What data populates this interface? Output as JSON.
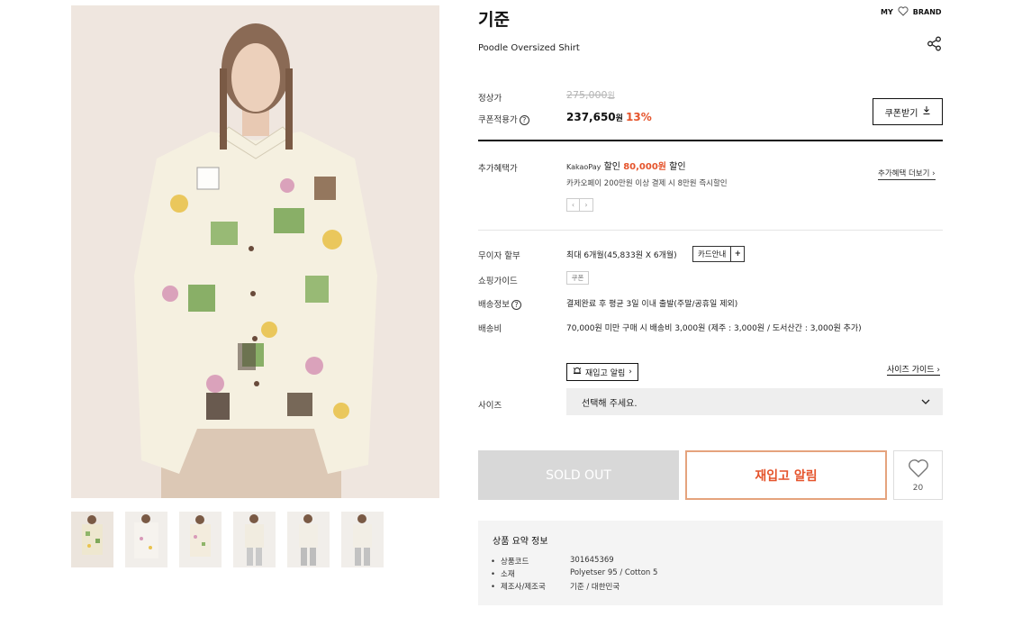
{
  "header": {
    "brand": "기준",
    "product_name": "Poodle Oversized Shirt",
    "my_label": "MY",
    "brand_link": "BRAND"
  },
  "gallery": {
    "thumbnail_count": 6
  },
  "price": {
    "regular_label": "정상가",
    "regular_value": "275,000",
    "regular_unit": "원",
    "coupon_label": "쿠폰적용가",
    "sale_value": "237,650",
    "sale_unit": "원",
    "discount": "13%",
    "coupon_button": "쿠폰받기"
  },
  "benefit": {
    "label": "추가혜택가",
    "provider": "KakaoPay",
    "prefix": "할인",
    "amount": "80,000원",
    "suffix": "할인",
    "sub": "카카오페이 200만원 이상 결제 시 8만원 즉시할인",
    "more": "추가혜택 더보기",
    "prev": "‹",
    "next": "›"
  },
  "installment": {
    "label": "무이자 할부",
    "value": "최대 6개월(45,833원 X 6개월)",
    "card_guide": "카드안내",
    "plus": "+"
  },
  "shopping_guide": {
    "label": "쇼핑가이드",
    "tag": "쿠폰"
  },
  "delivery_info": {
    "label": "배송정보",
    "value": "결제완료 후 평균 3일 이내 출발(주말/공휴일 제외)"
  },
  "delivery_fee": {
    "label": "배송비",
    "value": "70,000원 미만 구매 시 배송비 3,000원 (제주 : 3,000원 / 도서산간 : 3,000원 추가)"
  },
  "size": {
    "label": "사이즈",
    "restock_small": "재입고 알림",
    "size_guide": "사이즈 가이드",
    "placeholder": "선택해 주세요."
  },
  "actions": {
    "sold_out": "SOLD OUT",
    "restock": "재입고 알림",
    "wish_count": "20"
  },
  "summary": {
    "title": "상품 요약 정보",
    "rows": [
      {
        "key": "상품코드",
        "value": "301645369"
      },
      {
        "key": "소재",
        "value": "Polyetser 95 / Cotton 5"
      },
      {
        "key": "제조사/제조국",
        "value": "기준 / 대한민국"
      }
    ]
  },
  "colors": {
    "accent": "#e5542c",
    "accent_border": "#e5a37d",
    "sold_out_bg": "#d8d8d8"
  }
}
